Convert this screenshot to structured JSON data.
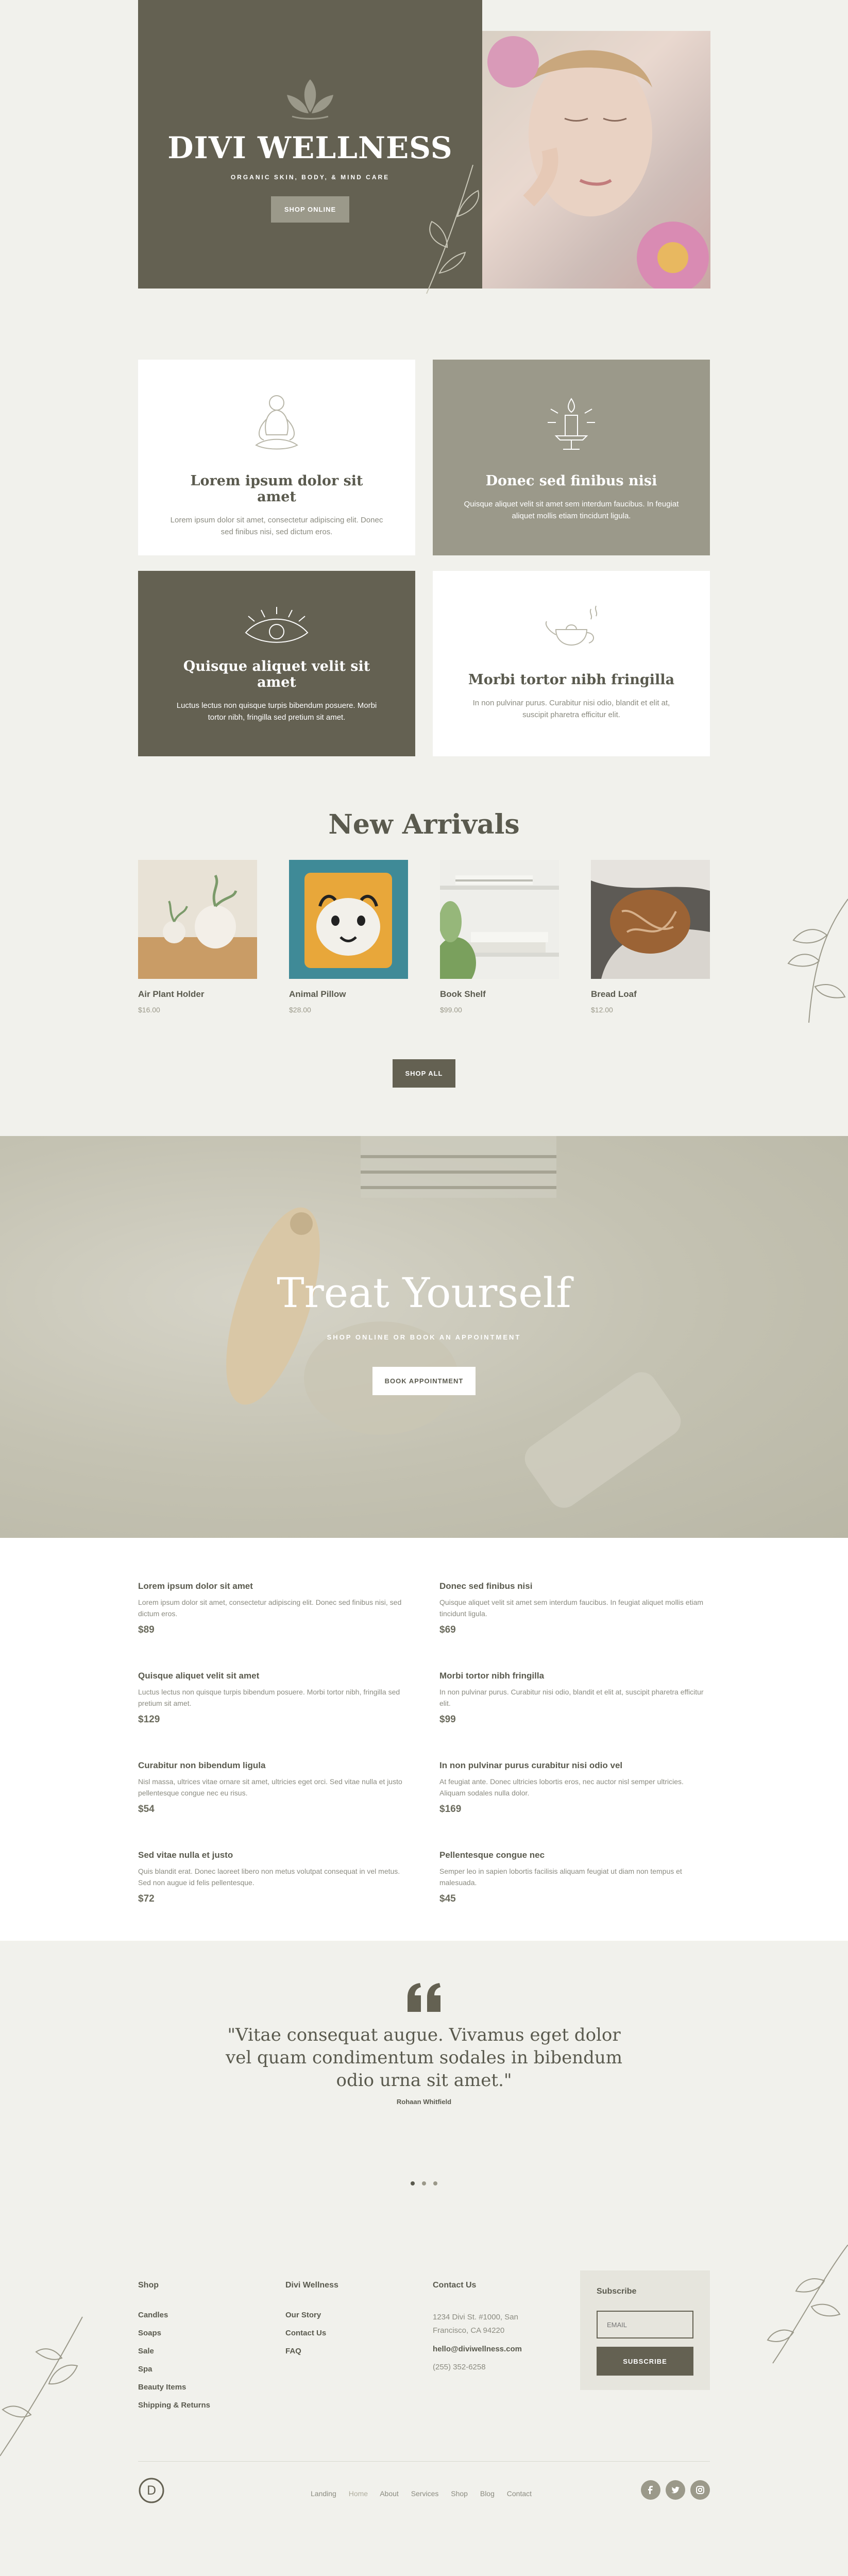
{
  "hero": {
    "title": "DIVI WELLNESS",
    "subtitle": "ORGANIC SKIN, BODY, & MIND CARE",
    "button": "SHOP ONLINE"
  },
  "features": [
    {
      "title": "Lorem ipsum dolor sit amet",
      "text": "Lorem ipsum dolor sit amet, consectetur adipiscing elit. Donec sed finibus nisi, sed dictum eros.",
      "icon": "meditation-icon"
    },
    {
      "title": "Donec sed finibus nisi",
      "text": "Quisque aliquet velit sit amet sem interdum faucibus. In feugiat aliquet mollis etiam tincidunt ligula.",
      "icon": "candle-icon"
    },
    {
      "title": "Quisque aliquet velit sit amet",
      "text": "Luctus lectus non quisque turpis bibendum posuere. Morbi tortor nibh, fringilla sed pretium sit amet.",
      "icon": "eye-icon"
    },
    {
      "title": "Morbi tortor nibh fringilla",
      "text": "In non pulvinar purus. Curabitur nisi odio, blandit et elit at, suscipit pharetra efficitur elit.",
      "icon": "teapot-icon"
    }
  ],
  "arrivals": {
    "heading": "New Arrivals",
    "button": "SHOP ALL",
    "products": [
      {
        "name": "Air Plant Holder",
        "price": "$16.00"
      },
      {
        "name": "Animal Pillow",
        "price": "$28.00"
      },
      {
        "name": "Book Shelf",
        "price": "$99.00"
      },
      {
        "name": "Bread Loaf",
        "price": "$12.00"
      }
    ]
  },
  "treat": {
    "title": "Treat Yourself",
    "subtitle": "SHOP ONLINE OR BOOK AN APPOINTMENT",
    "button": "BOOK APPOINTMENT"
  },
  "menu": [
    {
      "title": "Lorem ipsum dolor sit amet",
      "text": "Lorem ipsum dolor sit amet, consectetur adipiscing elit. Donec sed finibus nisi, sed dictum eros.",
      "price": "$89"
    },
    {
      "title": "Donec sed finibus nisi",
      "text": "Quisque aliquet velit sit amet sem interdum faucibus. In feugiat aliquet mollis etiam tincidunt ligula.",
      "price": "$69"
    },
    {
      "title": "Quisque aliquet velit sit amet",
      "text": "Luctus lectus non quisque turpis bibendum posuere. Morbi tortor nibh, fringilla sed pretium sit amet.",
      "price": "$129"
    },
    {
      "title": "Morbi tortor nibh fringilla",
      "text": "In non pulvinar purus. Curabitur nisi odio, blandit et elit at, suscipit pharetra efficitur elit.",
      "price": "$99"
    },
    {
      "title": "Curabitur non bibendum ligula",
      "text": "Nisl massa, ultrices vitae ornare sit amet, ultricies eget orci. Sed vitae nulla et justo pellentesque congue nec eu risus.",
      "price": "$54"
    },
    {
      "title": "In non pulvinar purus curabitur nisi odio vel",
      "text": "At feugiat ante. Donec ultricies lobortis eros, nec auctor nisl semper ultricies. Aliquam sodales nulla dolor.",
      "price": "$169"
    },
    {
      "title": "Sed vitae nulla et justo",
      "text": "Quis blandit erat. Donec laoreet libero non metus volutpat consequat in vel metus. Sed non augue id felis pellentesque.",
      "price": "$72"
    },
    {
      "title": "Pellentesque congue nec",
      "text": "Semper leo in sapien lobortis facilisis aliquam feugiat ut diam non tempus et malesuada.",
      "price": "$45"
    }
  ],
  "testimonial": {
    "quote": "\"Vitae consequat augue. Vivamus eget dolor vel quam condimentum sodales in bibendum odio urna sit amet.\"",
    "author": "Rohaan Whitfield"
  },
  "footer": {
    "shop_heading": "Shop",
    "shop_links": [
      "Candles",
      "Soaps",
      "Sale",
      "Spa",
      "Beauty Items",
      "Shipping & Returns"
    ],
    "divi_heading": "Divi Wellness",
    "divi_links": [
      "Our Story",
      "Contact Us",
      "FAQ"
    ],
    "contact_heading": "Contact Us",
    "address": "1234 Divi St. #1000, San Francisco, CA 94220",
    "email": "hello@diviwellness.com",
    "phone": "(255) 352-6258",
    "subscribe_heading": "Subscribe",
    "email_placeholder": "EMAIL",
    "subscribe_button": "SUBSCRIBE",
    "nav": [
      "Landing",
      "Home",
      "About",
      "Services",
      "Shop",
      "Blog",
      "Contact"
    ],
    "logo_letter": "D"
  },
  "colors": {
    "dark": "#646152",
    "taupe": "#9b998a",
    "bg": "#f1f1ec"
  }
}
